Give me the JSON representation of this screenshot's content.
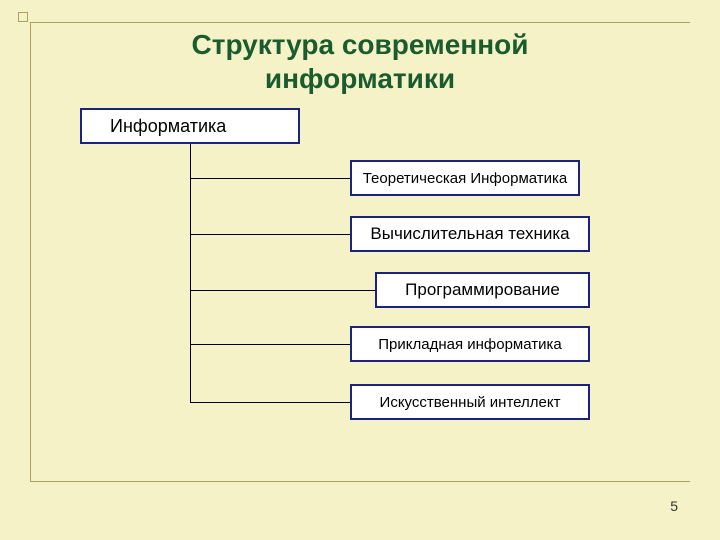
{
  "title_line1": "Структура современной",
  "title_line2": "информатики",
  "root": "Информатика",
  "children": {
    "c1": "Теоретическая Информатика",
    "c2": "Вычислительная техника",
    "c3": "Программирование",
    "c4": "Прикладная информатика",
    "c5": "Искусственный интеллект"
  },
  "page_number": "5"
}
